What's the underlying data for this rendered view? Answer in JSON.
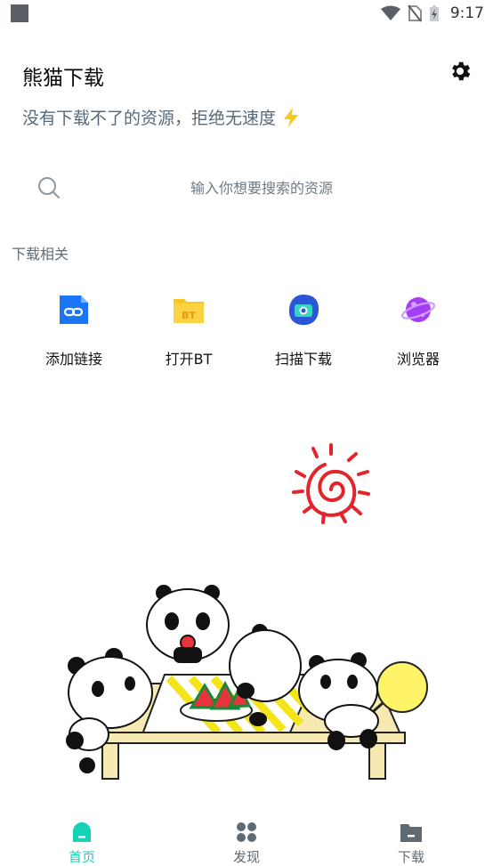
{
  "status_bar": {
    "time": "9:17"
  },
  "header": {
    "title": "熊猫下载",
    "subtitle": "没有下载不了的资源，拒绝无速度"
  },
  "search": {
    "placeholder": "输入你想要搜索的资源"
  },
  "section": {
    "title": "下载相关"
  },
  "quick_actions": [
    {
      "label": "添加链接",
      "icon": "link-icon",
      "color": "#1b74f5"
    },
    {
      "label": "打开BT",
      "icon": "bt-folder-icon",
      "color": "#f8c61f"
    },
    {
      "label": "扫描下载",
      "icon": "scan-camera-icon",
      "color": "#2b56d8"
    },
    {
      "label": "浏览器",
      "icon": "planet-icon",
      "color": "#a43ef2"
    }
  ],
  "tabs": [
    {
      "label": "首页",
      "icon": "home-icon",
      "active": true
    },
    {
      "label": "发现",
      "icon": "discover-icon",
      "active": false
    },
    {
      "label": "下载",
      "icon": "download-folder-icon",
      "active": false
    }
  ],
  "colors": {
    "accent": "#16d3b8",
    "inactive": "#5f6a73"
  }
}
